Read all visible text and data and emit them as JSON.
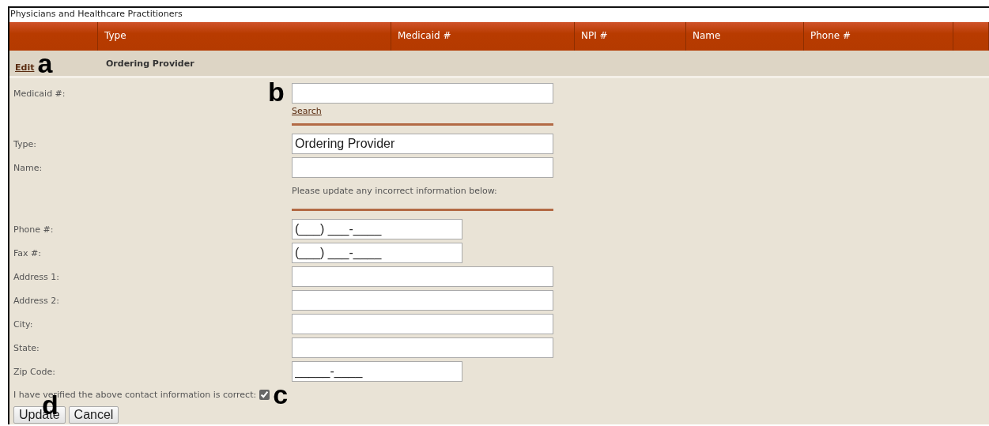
{
  "window": {
    "title": "Physicians and Healthcare Practitioners"
  },
  "table": {
    "columns": [
      "Type",
      "Medicaid #",
      "NPI #",
      "Name",
      "Phone #"
    ],
    "rows": [
      {
        "action": "Edit",
        "callout": "a",
        "type": "Ordering Provider"
      }
    ]
  },
  "form": {
    "fields": [
      {
        "kind": "lookup",
        "label": "Medicaid #:",
        "callout": "b",
        "link": "Search"
      },
      {
        "kind": "divider"
      },
      {
        "kind": "long",
        "label": "Type:",
        "value": "Ordering Provider"
      },
      {
        "kind": "long",
        "label": "Name:"
      },
      {
        "kind": "note",
        "text": "Please update any incorrect information below:"
      },
      {
        "kind": "divider"
      },
      {
        "kind": "short",
        "label": "Phone #:",
        "value": "(___) ___-____"
      },
      {
        "kind": "short",
        "label": "Fax #:",
        "value": "(___) ___-____"
      },
      {
        "kind": "long",
        "label": "Address 1:"
      },
      {
        "kind": "long",
        "label": "Address 2:"
      },
      {
        "kind": "long",
        "label": "City:"
      },
      {
        "kind": "long",
        "label": "State:"
      },
      {
        "kind": "short",
        "label": "Zip Code:",
        "value": "_____-____"
      }
    ],
    "confirm": {
      "label": "I have verified the above contact information is correct:",
      "checked": true,
      "callout": "c"
    },
    "buttons": [
      "Update",
      "Cancel"
    ],
    "buttons_callout": "d"
  }
}
